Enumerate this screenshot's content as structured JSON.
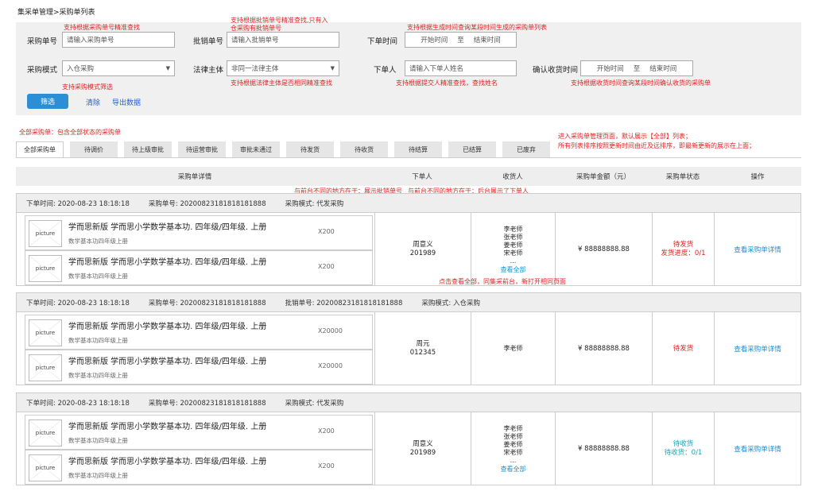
{
  "breadcrumb": "集采单管理>采购单列表",
  "filters": {
    "order_no_label": "采购单号",
    "order_no_placeholder": "请输入采购单号",
    "batch_no_label": "批销单号",
    "batch_no_placeholder": "请输入批销单号",
    "time_label": "下单时间",
    "start_time": "开始时间",
    "to": "至",
    "end_time": "结束时间",
    "mode_label": "采购模式",
    "mode_value": "入仓采购",
    "legal_label": "法律主体",
    "legal_value": "非同一法律主体",
    "orderer_label": "下单人",
    "orderer_placeholder": "请输入下单人姓名",
    "receipt_label": "确认收货时间",
    "receipt_start": "开始时间",
    "receipt_end": "结束时间",
    "filter_btn": "筛选",
    "clear_btn": "清除",
    "export_btn": "导出数据"
  },
  "notes": {
    "n1": "支持根据采购单号精准查找",
    "n2a": "支持根据批销单号精准查找,只有入",
    "n2b": "仓采购有批销单号",
    "n3": "支持根据生成时间查询某段时间生成的采购单列表",
    "n4": "支持采购模式筛选",
    "n5": "支持根据法律主体是否相同精准查找",
    "n6": "支持根据提交人精准查找，查找姓名",
    "n7": "支持根据收货时间查询某段时间确认收货的采购单",
    "n8": "全部采购单：包含全部状态的采购单",
    "n9a": "进入采购单管理页面，默认展示【全部】列表；",
    "n9b": "所有列表排序按照更新时间由近及远排序，即最新更新的展示在上面；",
    "n10": "与前台不同的地方在于：展示批销单号",
    "n11": "与前台不同的地方在于：后台展示了下单人",
    "n12": "点击查看全部，同集采前台，新打开相同页面"
  },
  "tabs": [
    "全部采购单",
    "待调价",
    "待上级审批",
    "待运营审批",
    "审批未通过",
    "待发货",
    "待收货",
    "待结算",
    "已结算",
    "已废弃"
  ],
  "table_headers": {
    "detail": "采购单详情",
    "orderer": "下单人",
    "receiver": "收货人",
    "amount": "采购单金额（元）",
    "status": "采购单状态",
    "action": "操作"
  },
  "orders": [
    {
      "time_label": "下单时间:",
      "time": "2020-08-23  18:18:18",
      "no_label": "采购单号:",
      "no": "20200823181818181888",
      "batch_label": "",
      "batch_no": "",
      "mode_label": "采购模式:",
      "mode": "代发采购",
      "items": [
        {
          "picture": "picture",
          "name": "学而思新版 学而思小学数学基本功. 四年级/四年级. 上册",
          "sub": "数学基本功四年级上册",
          "qty": "X200"
        },
        {
          "picture": "picture",
          "name": "学而思新版 学而思小学数学基本功. 四年级/四年级. 上册",
          "sub": "数学基本功四年级上册",
          "qty": "X200"
        }
      ],
      "buyer_name": "周意义",
      "buyer_id": "201989",
      "receivers": [
        "李老师",
        "张老师",
        "姜老师",
        "宋老师",
        "..."
      ],
      "view_all": "查看全部",
      "amount": "¥ 88888888.88",
      "status": "待发货",
      "progress": "发货进度：0/1",
      "action": "查看采购单详情"
    },
    {
      "time_label": "下单时间:",
      "time": "2020-08-23  18:18:18",
      "no_label": "采购单号:",
      "no": "20200823181818181888",
      "batch_label": "批销单号:",
      "batch_no": "20200823181818181888",
      "mode_label": "采购模式:",
      "mode": "入仓采购",
      "items": [
        {
          "picture": "picture",
          "name": "学而思新版 学而思小学数学基本功. 四年级/四年级. 上册",
          "sub": "数学基本功四年级上册",
          "qty": "X20000"
        },
        {
          "picture": "picture",
          "name": "学而思新版 学而思小学数学基本功. 四年级/四年级. 上册",
          "sub": "数学基本功四年级上册",
          "qty": "X20000"
        }
      ],
      "buyer_name": "周元",
      "buyer_id": "012345",
      "receiver_single": "李老师",
      "amount": "¥ 88888888.88",
      "status": "待发货",
      "action": "查看采购单详情"
    },
    {
      "time_label": "下单时间:",
      "time": "2020-08-23  18:18:18",
      "no_label": "采购单号:",
      "no": "20200823181818181888",
      "batch_label": "",
      "batch_no": "",
      "mode_label": "采购模式:",
      "mode": "代发采购",
      "items": [
        {
          "picture": "picture",
          "name": "学而思新版 学而思小学数学基本功. 四年级/四年级. 上册",
          "sub": "数学基本功四年级上册",
          "qty": "X200"
        },
        {
          "picture": "picture",
          "name": "学而思新版 学而思小学数学基本功. 四年级/四年级. 上册",
          "sub": "数学基本功四年级上册",
          "qty": "X200"
        }
      ],
      "buyer_name": "周意义",
      "buyer_id": "201989",
      "receivers": [
        "李老师",
        "张老师",
        "姜老师",
        "宋老师",
        "..."
      ],
      "view_all": "查看全部",
      "amount": "¥ 88888888.88",
      "status": "待收货",
      "progress": "待收货：0/1",
      "action": "查看采购单详情"
    }
  ]
}
